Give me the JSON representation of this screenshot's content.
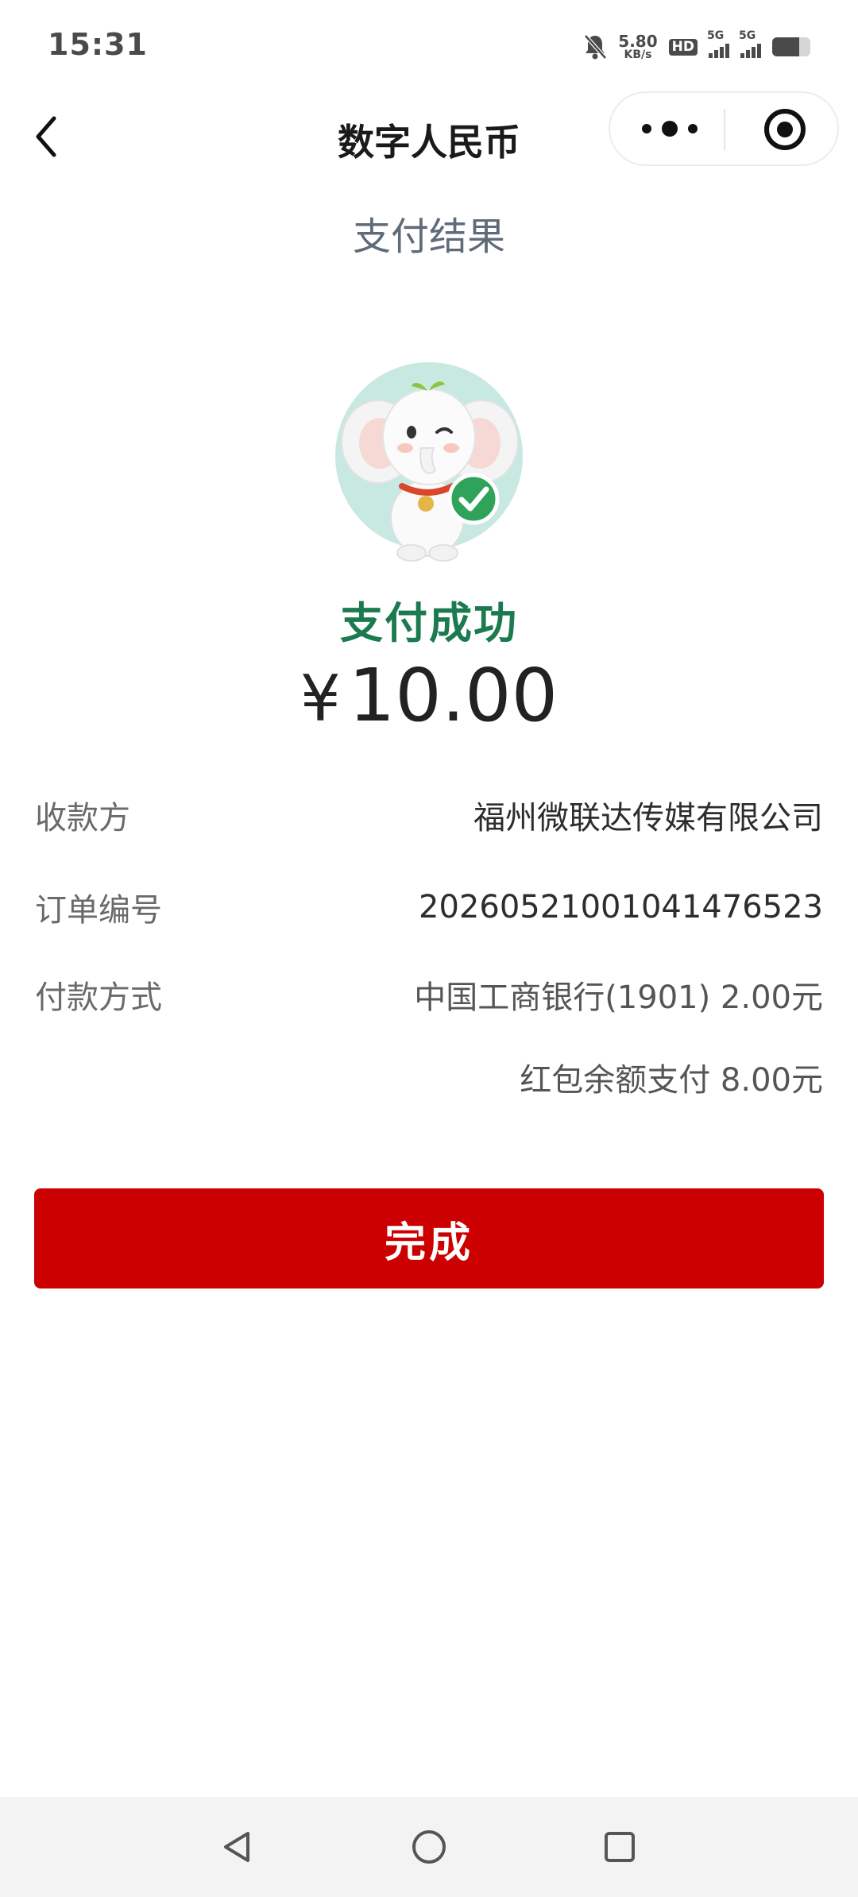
{
  "status_bar": {
    "time": "15:31",
    "speed_value": "5.80",
    "speed_unit": "KB/s",
    "hd_badge": "HD",
    "sim1_label": "5G",
    "sim2_label": "5G"
  },
  "nav": {
    "title": "数字人民币"
  },
  "result": {
    "heading": "支付结果",
    "status": "支付成功",
    "currency_symbol": "¥",
    "amount": "10.00"
  },
  "details": [
    {
      "label": "收款方",
      "value": "福州微联达传媒有限公司"
    },
    {
      "label": "订单编号",
      "value": "20260521001041476523"
    },
    {
      "label": "付款方式",
      "value": "中国工商银行(1901) 2.00元"
    },
    {
      "label": "",
      "value": "红包余额支付 8.00元"
    }
  ],
  "actions": {
    "done_label": "完成"
  },
  "colors": {
    "accent_red": "#cc0000",
    "success_green": "#1b7a4e",
    "heading_gray": "#5f6b78"
  },
  "icons": [
    "back-icon",
    "more-icon",
    "close-mini-program-icon",
    "check-icon",
    "back-triangle-icon",
    "home-circle-icon",
    "recents-square-icon"
  ]
}
